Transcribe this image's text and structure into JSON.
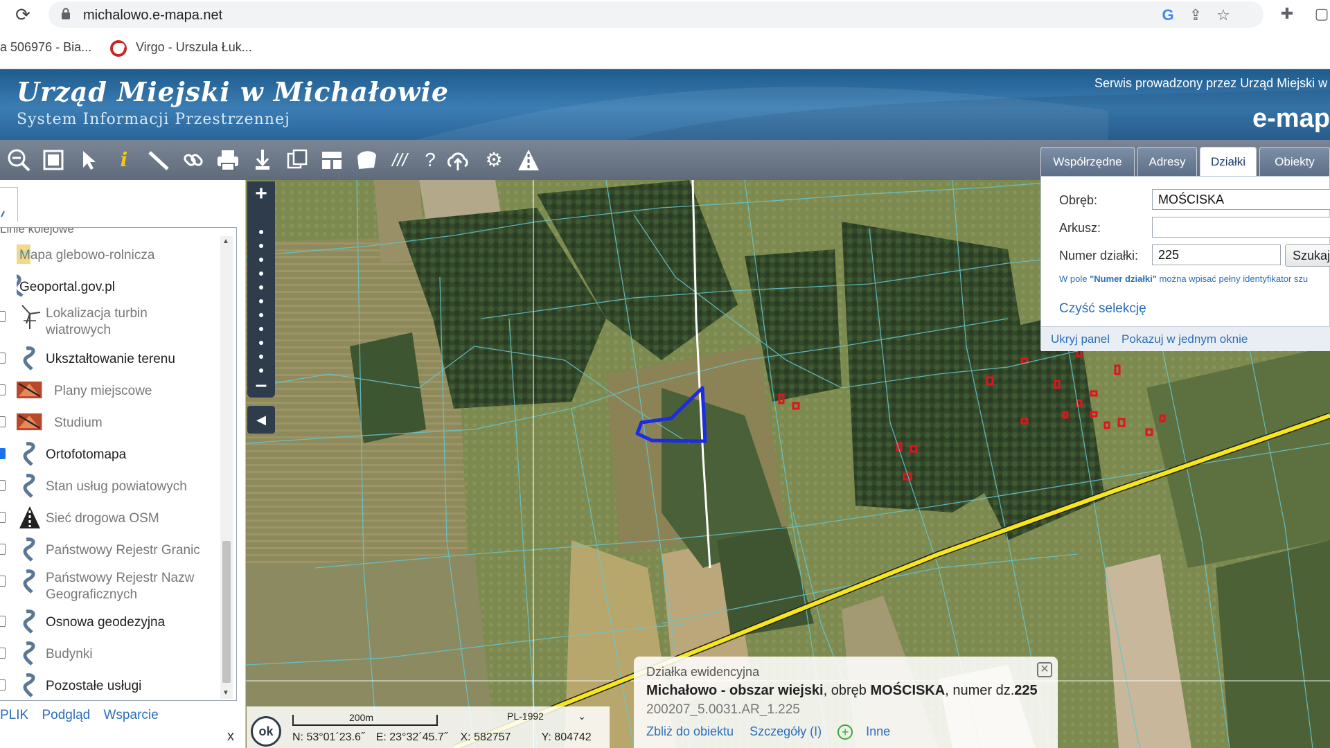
{
  "browser": {
    "url": "michalowo.e-mapa.net",
    "bookmarks": [
      "a 506976 - Bia...",
      "Virgo - Urszula Łuk..."
    ]
  },
  "header": {
    "title": "Urząd Miejski w Michałowie",
    "subtitle": "System Informacji Przestrzennej",
    "service": "Serwis prowadzony przez Urząd Miejski w",
    "brand": "e-mapa"
  },
  "tabs": [
    {
      "label": "Współrzędne",
      "active": false
    },
    {
      "label": "Adresy",
      "active": false
    },
    {
      "label": "Działki",
      "active": true
    },
    {
      "label": "Obiekty",
      "active": false
    }
  ],
  "layers": {
    "partial_top": "Linie kolejowe",
    "items": [
      {
        "label": "Mapa glebowo-rolnicza",
        "checked": null,
        "style": "grey",
        "icon": "soil-map-icon"
      },
      {
        "label": "Geoportal.gov.pl",
        "checked": null,
        "style": "bold",
        "icon": "geoportal-icon"
      },
      {
        "label": "Lokalizacja turbin wiatrowych",
        "checked": false,
        "style": "grey",
        "icon": "wind-turbine-icon"
      },
      {
        "label": "Ukształtowanie terenu",
        "checked": false,
        "style": "bold",
        "icon": "geoportal-icon"
      },
      {
        "label": "Plany miejscowe",
        "checked": false,
        "style": "grey",
        "icon": "plans-icon"
      },
      {
        "label": "Studium",
        "checked": false,
        "style": "grey",
        "icon": "plans-icon"
      },
      {
        "label": "Ortofotomapa",
        "checked": true,
        "style": "bold",
        "icon": "geoportal-icon"
      },
      {
        "label": "Stan usług powiatowych",
        "checked": false,
        "style": "grey",
        "icon": "geoportal-icon"
      },
      {
        "label": "Sieć drogowa OSM",
        "checked": false,
        "style": "grey",
        "icon": "road-network-icon"
      },
      {
        "label": "Państwowy Rejestr Granic",
        "checked": false,
        "style": "grey",
        "icon": "geoportal-icon"
      },
      {
        "label": "Państwowy Rejestr Nazw Geograficznych",
        "checked": false,
        "style": "grey",
        "icon": "geoportal-icon"
      },
      {
        "label": "Osnowa geodezyjna",
        "checked": false,
        "style": "bold",
        "icon": "geoportal-icon"
      },
      {
        "label": "Budynki",
        "checked": false,
        "style": "grey",
        "icon": "geoportal-icon"
      },
      {
        "label": "Pozostałe usługi",
        "checked": false,
        "style": "bold",
        "icon": "geoportal-icon"
      }
    ],
    "links": [
      "PLIK",
      "Podgląd",
      "Wsparcie"
    ],
    "close": "x"
  },
  "search": {
    "obreb_label": "Obręb:",
    "obreb_value": "MOŚCISKA",
    "arkusz_label": "Arkusz:",
    "arkusz_value": "",
    "numer_label": "Numer działki:",
    "numer_value": "225",
    "search_btn": "Szukaj",
    "hint_prefix": "W pole ",
    "hint_bold": "\"Numer działki\"",
    "hint_suffix": " można wpisać pełny identyfikator szu",
    "clear": "Czyść selekcję",
    "hide_panel": "Ukryj panel",
    "one_window": "Pokazuj w jednym oknie"
  },
  "popup": {
    "title": "Działka ewidencyjna",
    "place": "Michałowo - obszar wiejski",
    "mid1": ", obręb ",
    "precinct": "MOŚCISKA",
    "mid2": ", numer dz.",
    "parcel": "225",
    "id": "200207_5.0031.AR_1.225",
    "zoom": "Zbliż do obiektu",
    "details": "Szczegóły (I)",
    "other": "Inne"
  },
  "status": {
    "ok": "ok",
    "scale": "200m",
    "crs": "PL-1992",
    "n": "N: 53°01´23.6˝",
    "e": "E: 23°32´45.7˝",
    "x": "X: 582757",
    "y": "Y: 804742"
  }
}
